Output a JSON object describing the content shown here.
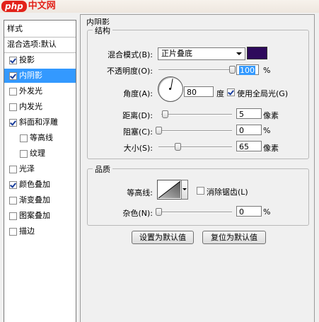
{
  "header": {
    "logo_php": "php",
    "logo_cn": "中文网"
  },
  "left_panel": {
    "items": [
      {
        "label": "样式",
        "checkbox": false
      },
      {
        "label": "混合选项:默认",
        "checkbox": false
      },
      {
        "label": "投影",
        "checkbox": true,
        "checked": true
      },
      {
        "label": "内阴影",
        "checkbox": true,
        "checked": true,
        "selected": true
      },
      {
        "label": "外发光",
        "checkbox": true,
        "checked": false
      },
      {
        "label": "内发光",
        "checkbox": true,
        "checked": false
      },
      {
        "label": "斜面和浮雕",
        "checkbox": true,
        "checked": true
      },
      {
        "label": "等高线",
        "checkbox": true,
        "checked": false,
        "sub": true
      },
      {
        "label": "纹理",
        "checkbox": true,
        "checked": false,
        "sub": true
      },
      {
        "label": "光泽",
        "checkbox": true,
        "checked": false
      },
      {
        "label": "颜色叠加",
        "checkbox": true,
        "checked": true
      },
      {
        "label": "渐变叠加",
        "checkbox": true,
        "checked": false
      },
      {
        "label": "图案叠加",
        "checkbox": true,
        "checked": false
      },
      {
        "label": "描边",
        "checkbox": true,
        "checked": false
      }
    ]
  },
  "panel": {
    "title": "内阴影",
    "structure": {
      "title": "结构",
      "blend_mode_label": "混合模式(B):",
      "blend_mode_value": "正片叠底",
      "blend_color": "#2e0a5c",
      "opacity_label": "不透明度(O):",
      "opacity_value": "100",
      "opacity_fraction": 1.0,
      "opacity_unit": "%",
      "angle_label": "角度(A):",
      "angle_value": "80",
      "angle_unit": "度",
      "global_light_label": "使用全局光(G)",
      "global_light_checked": true,
      "distance_label": "距离(D):",
      "distance_value": "5",
      "distance_fraction": 0.05,
      "distance_unit": "像素",
      "choke_label": "阻塞(C):",
      "choke_value": "0",
      "choke_fraction": 0.0,
      "choke_unit": "%",
      "size_label": "大小(S):",
      "size_value": "65",
      "size_fraction": 0.26,
      "size_unit": "像素"
    },
    "quality": {
      "title": "品质",
      "contour_label": "等高线:",
      "antialias_label": "消除锯齿(L)",
      "antialias_checked": false,
      "noise_label": "杂色(N):",
      "noise_value": "0",
      "noise_fraction": 0.0,
      "noise_unit": "%"
    },
    "buttons": {
      "set_default": "设置为默认值",
      "reset_default": "复位为默认值"
    }
  }
}
